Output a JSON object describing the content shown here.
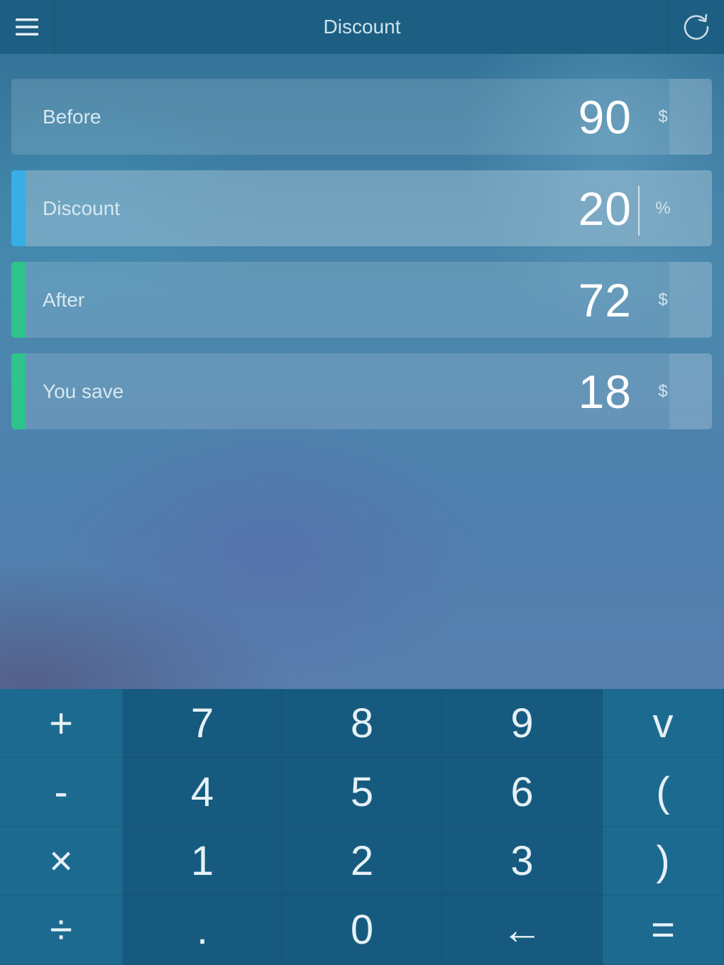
{
  "header": {
    "title": "Discount",
    "menu_icon": "hamburger-menu-icon",
    "refresh_icon": "refresh-icon"
  },
  "fields": [
    {
      "label": "Before",
      "value": "90",
      "unit": "$",
      "accent": null
    },
    {
      "label": "Discount",
      "value": "20",
      "unit": "%",
      "accent": "#38aee6"
    },
    {
      "label": "After",
      "value": "72",
      "unit": "$",
      "accent": "#2ec48c"
    },
    {
      "label": "You save",
      "value": "18",
      "unit": "$",
      "accent": "#2ec48c"
    }
  ],
  "keypad": {
    "rows": [
      [
        "+",
        "7",
        "8",
        "9",
        "v"
      ],
      [
        "-",
        "4",
        "5",
        "6",
        "("
      ],
      [
        "×",
        "1",
        "2",
        "3",
        ")"
      ],
      [
        "÷",
        ".",
        "0",
        "←",
        "="
      ]
    ]
  },
  "colors": {
    "header_bg": "#1d5f82",
    "keypad_num_bg": "#165b7f",
    "keypad_op_bg": "#1d6a90",
    "accent_blue": "#38aee6",
    "accent_green": "#2ec48c"
  }
}
